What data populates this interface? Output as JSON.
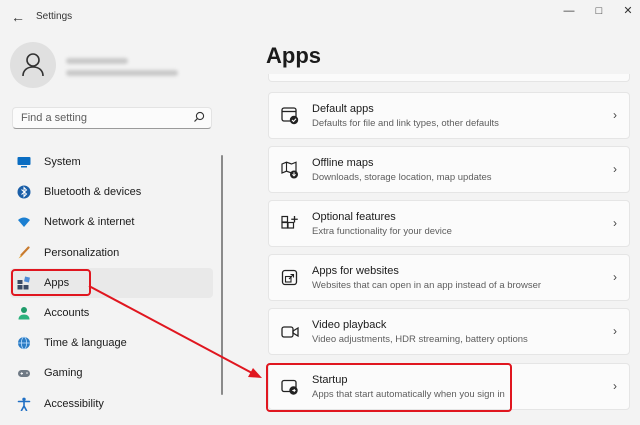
{
  "window": {
    "title": "Settings"
  },
  "sidebar": {
    "search_placeholder": "Find a setting",
    "items": [
      {
        "label": "System",
        "icon": "monitor-icon"
      },
      {
        "label": "Bluetooth & devices",
        "icon": "bluetooth-icon"
      },
      {
        "label": "Network & internet",
        "icon": "wifi-icon"
      },
      {
        "label": "Personalization",
        "icon": "brush-icon"
      },
      {
        "label": "Apps",
        "icon": "apps-icon",
        "selected": true
      },
      {
        "label": "Accounts",
        "icon": "person-icon"
      },
      {
        "label": "Time & language",
        "icon": "globe-clock-icon"
      },
      {
        "label": "Gaming",
        "icon": "gamepad-icon"
      },
      {
        "label": "Accessibility",
        "icon": "accessibility-icon"
      }
    ]
  },
  "main": {
    "title": "Apps",
    "cards": [
      {
        "title": "Default apps",
        "description": "Defaults for file and link types, other defaults",
        "icon": "default-apps-icon"
      },
      {
        "title": "Offline maps",
        "description": "Downloads, storage location, map updates",
        "icon": "map-icon"
      },
      {
        "title": "Optional features",
        "description": "Extra functionality for your device",
        "icon": "optional-features-icon"
      },
      {
        "title": "Apps for websites",
        "description": "Websites that can open in an app instead of a browser",
        "icon": "open-in-app-icon"
      },
      {
        "title": "Video playback",
        "description": "Video adjustments, HDR streaming, battery options",
        "icon": "video-icon"
      },
      {
        "title": "Startup",
        "description": "Apps that start automatically when you sign in",
        "icon": "startup-icon"
      }
    ]
  },
  "annotation": {
    "color": "#e0161f"
  }
}
